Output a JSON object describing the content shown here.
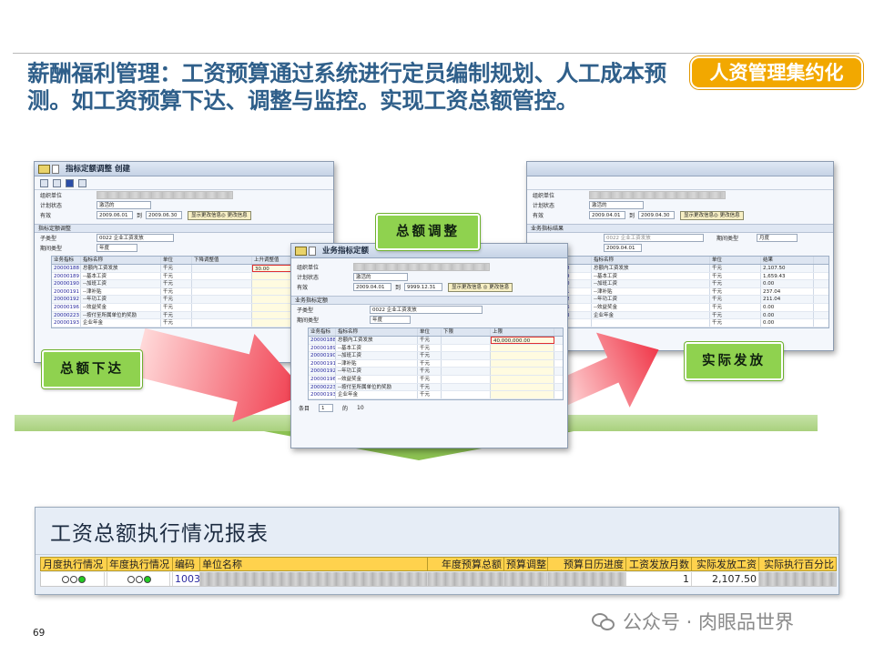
{
  "slide": {
    "title": "薪酬福利管理：工资预算通过系统进行定员编制规划、人工成本预测。如工资预算下达、调整与监控。实现工资总额管控。",
    "badge": "人资管理集约化",
    "page_number": "69",
    "watermark": "公众号 · 肉眼品世界"
  },
  "callouts": {
    "issue": "总额下达",
    "adjust": "总额调整",
    "actual": "实际发放"
  },
  "win_left": {
    "title": "指标定额调整 创建",
    "fields": {
      "org_label": "组织单位",
      "plan_label": "计划状态",
      "plan_value": "激活的",
      "valid_label": "有效",
      "date_from": "2009.06.01",
      "to_label": "到",
      "date_to": "2009.06.30",
      "button": "显示更改信息◎ 更改信息"
    },
    "section": "指标定额调整",
    "subtype_label": "子类型",
    "subtype_value": "0022 企业工资发放",
    "period_label": "期间类型",
    "period_value": "年度",
    "columns": [
      "业务指标",
      "指标名称",
      "单位",
      "下降调整值",
      "上升调整值"
    ],
    "rows": [
      [
        "20000188",
        "总额内工资发放",
        "千元",
        "",
        "30.00"
      ],
      [
        "20000189",
        "--基本工资",
        "千元",
        "",
        ""
      ],
      [
        "20000190",
        "--加班工资",
        "千元",
        "",
        ""
      ],
      [
        "20000191",
        "--津补贴",
        "千元",
        "",
        ""
      ],
      [
        "20000192",
        "--年功工资",
        "千元",
        "",
        ""
      ],
      [
        "20000196",
        "--效益奖金",
        "千元",
        "",
        ""
      ],
      [
        "20000223",
        "--按付至所属单位的奖励",
        "千元",
        "",
        ""
      ],
      [
        "20000193",
        "企业年金",
        "千元",
        "",
        ""
      ]
    ]
  },
  "win_mid": {
    "title": "业务指标定额",
    "fields": {
      "org_label": "组织单位",
      "plan_label": "计划状态",
      "plan_value": "激活的",
      "valid_label": "有效",
      "date_from": "2009.04.01",
      "to_label": "到",
      "date_to": "9999.12.31",
      "button": "显示更改信息 ◎ 更改信息"
    },
    "section": "业务指标定额",
    "subtype_label": "子类型",
    "subtype_value": "0022 企业工资发放",
    "period_label": "期间类型",
    "period_value": "年度",
    "columns": [
      "业务指标",
      "指标名称",
      "单位",
      "下限",
      "上限"
    ],
    "rows": [
      [
        "20000188",
        "总额内工资发放",
        "千元",
        "",
        "40,000,000.00"
      ],
      [
        "20000189",
        "--基本工资",
        "千元",
        "",
        ""
      ],
      [
        "20000190",
        "--加班工资",
        "千元",
        "",
        ""
      ],
      [
        "20000191",
        "--津补贴",
        "千元",
        "",
        ""
      ],
      [
        "20000192",
        "--年功工资",
        "千元",
        "",
        ""
      ],
      [
        "20000196",
        "--效益奖金",
        "千元",
        "",
        ""
      ],
      [
        "20000223",
        "--按付至所属单位的奖励",
        "千元",
        "",
        ""
      ],
      [
        "20000193",
        "企业年金",
        "千元",
        "",
        ""
      ]
    ],
    "pager": {
      "label": "条目",
      "current": "1",
      "of": "的",
      "total": "10"
    }
  },
  "win_right": {
    "fields": {
      "org_label": "组织单位",
      "plan_label": "计划状态",
      "plan_value": "激活的",
      "valid_label": "有效",
      "date_from": "2009.04.01",
      "to_label": "到",
      "date_to": "2009.04.30",
      "button": "显示更改信息◎ 更改信息"
    },
    "section": "业务指标结果",
    "subtype_value": "0022 企业工资发放",
    "period_label": "期间类型",
    "period_value": "月度",
    "columns": [
      "",
      "指标名称",
      "单位",
      "结果"
    ],
    "rows": [
      [
        "8",
        "总额内工资发放",
        "千元",
        "2,107.50"
      ],
      [
        "9",
        "--基本工资",
        "千元",
        "1,659.43"
      ],
      [
        "0",
        "--加班工资",
        "千元",
        "0.00"
      ],
      [
        "1",
        "--津补贴",
        "千元",
        "237.04"
      ],
      [
        "2",
        "--年功工资",
        "千元",
        "211.04"
      ],
      [
        "6",
        "--效益奖金",
        "千元",
        "0.00"
      ],
      [
        "3",
        "企业年金",
        "千元",
        "0.00"
      ],
      [
        "",
        "",
        "千元",
        "0.00"
      ]
    ]
  },
  "report": {
    "title": "工资总额执行情况报表",
    "columns": [
      "月度执行情况",
      "年度执行情况",
      "编码",
      "单位名称",
      "年度预算总额",
      "预算调整",
      "预算日历进度",
      "工资发放月数",
      "实际发放工资",
      "实际执行百分比"
    ],
    "row": {
      "code": "1003",
      "months": "1",
      "actual": "2,107.50"
    }
  }
}
